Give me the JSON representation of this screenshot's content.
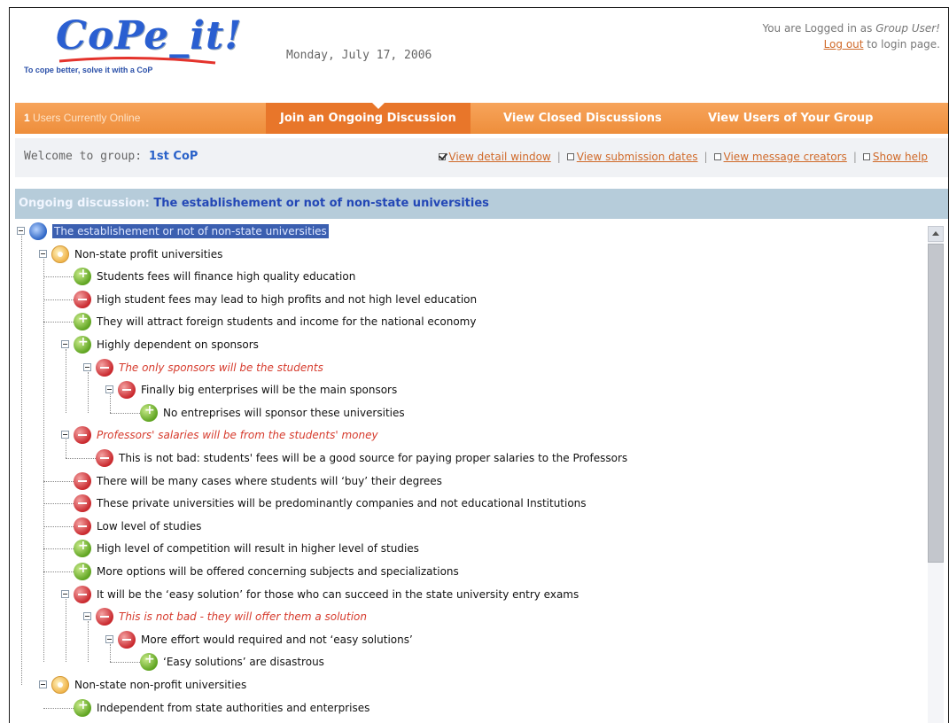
{
  "header": {
    "logo_text": "CoPe_it!",
    "logo_tagline": "To cope better, solve it with a CoP",
    "date": "Monday, July 17, 2006",
    "login_prefix": "You are Logged in as ",
    "login_user": "Group User!",
    "logout_link": "Log out",
    "logout_suffix": " to login page."
  },
  "navbar": {
    "online_count": "1",
    "online_text": " Users Currently Online",
    "tabs": [
      {
        "label": "Join an Ongoing Discussion",
        "active": true
      },
      {
        "label": "View Closed Discussions",
        "active": false
      },
      {
        "label": "View Users of Your Group",
        "active": false
      }
    ]
  },
  "welcome": {
    "prefix": "Welcome to group: ",
    "group": "1st CoP"
  },
  "options": [
    {
      "label": "View detail window",
      "checked": true
    },
    {
      "label": "View submission dates",
      "checked": false
    },
    {
      "label": "View message creators",
      "checked": false
    },
    {
      "label": "Show help",
      "checked": false
    }
  ],
  "discussion": {
    "label": "Ongoing discussion: ",
    "title": "The establishement or not of non-state universities"
  },
  "tree": [
    {
      "level": 0,
      "icon": "globe-icon",
      "type": "globe",
      "text": "The establishement or not of non-state universities",
      "expander": true,
      "style": "root"
    },
    {
      "level": 1,
      "icon": "issue-icon",
      "type": "issue",
      "text": "Non-state profit universities",
      "expander": true,
      "style": "normal"
    },
    {
      "level": 2,
      "icon": "pro-icon",
      "type": "pro",
      "text": "Students fees will finance high quality education",
      "expander": false,
      "style": "normal"
    },
    {
      "level": 2,
      "icon": "con-icon",
      "type": "con",
      "text": "High student fees may lead to high profits and not high level education",
      "expander": false,
      "style": "normal"
    },
    {
      "level": 2,
      "icon": "pro-icon",
      "type": "pro",
      "text": "They will attract foreign students and income for the national economy",
      "expander": false,
      "style": "normal"
    },
    {
      "level": 2,
      "icon": "pro-icon",
      "type": "pro",
      "text": "Highly dependent on sponsors",
      "expander": true,
      "style": "normal"
    },
    {
      "level": 3,
      "icon": "con-icon",
      "type": "con",
      "text": "The only sponsors will be the students",
      "expander": true,
      "style": "italic"
    },
    {
      "level": 4,
      "icon": "con-icon",
      "type": "con",
      "text": "Finally big enterprises will be the main sponsors",
      "expander": true,
      "style": "normal"
    },
    {
      "level": 5,
      "icon": "pro-icon",
      "type": "pro",
      "text": "No entreprises will sponsor these universities",
      "expander": false,
      "style": "normal"
    },
    {
      "level": 2,
      "icon": "con-icon",
      "type": "con",
      "text": "Professors' salaries will be from the students' money",
      "expander": true,
      "style": "italic"
    },
    {
      "level": 3,
      "icon": "con-icon",
      "type": "con",
      "text": "This is not bad: students' fees will be a good source for paying proper salaries to the Professors",
      "expander": false,
      "style": "normal"
    },
    {
      "level": 2,
      "icon": "con-icon",
      "type": "con",
      "text": "There will be many cases where students will ‘buy’ their degrees",
      "expander": false,
      "style": "normal"
    },
    {
      "level": 2,
      "icon": "con-icon",
      "type": "con",
      "text": "These private universities will be predominantly companies and not educational Institutions",
      "expander": false,
      "style": "normal"
    },
    {
      "level": 2,
      "icon": "con-icon",
      "type": "con",
      "text": "Low level of studies",
      "expander": false,
      "style": "normal"
    },
    {
      "level": 2,
      "icon": "pro-icon",
      "type": "pro",
      "text": "High level of competition will result in higher level of studies",
      "expander": false,
      "style": "normal"
    },
    {
      "level": 2,
      "icon": "pro-icon",
      "type": "pro",
      "text": "More options will be offered concerning subjects and specializations",
      "expander": false,
      "style": "normal"
    },
    {
      "level": 2,
      "icon": "con-icon",
      "type": "con",
      "text": "It will be the ‘easy solution’ for those who can succeed in the state university entry exams",
      "expander": true,
      "style": "normal"
    },
    {
      "level": 3,
      "icon": "con-icon",
      "type": "con",
      "text": "This is not bad - they will offer them a solution",
      "expander": true,
      "style": "italic"
    },
    {
      "level": 4,
      "icon": "con-icon",
      "type": "con",
      "text": "More effort would required and not ‘easy solutions’",
      "expander": true,
      "style": "normal"
    },
    {
      "level": 5,
      "icon": "pro-icon",
      "type": "pro",
      "text": "‘Easy solutions’ are disastrous",
      "expander": false,
      "style": "normal"
    },
    {
      "level": 1,
      "icon": "issue-icon",
      "type": "issue",
      "text": "Non-state non-profit universities",
      "expander": true,
      "style": "normal"
    },
    {
      "level": 2,
      "icon": "pro-icon",
      "type": "pro",
      "text": "Independent from state authorities and enterprises",
      "expander": false,
      "style": "normal"
    }
  ],
  "colors": {
    "accent_orange": "#ee8e3b",
    "active_tab": "#e8762a",
    "link": "#d06a2a",
    "group_blue": "#2a62c9",
    "italic_red": "#d63b2d"
  }
}
